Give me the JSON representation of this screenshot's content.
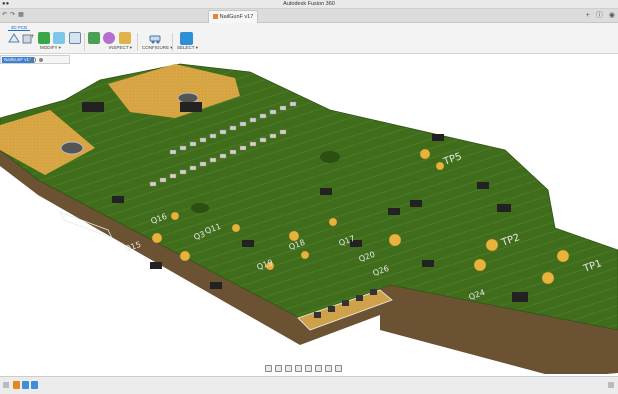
{
  "window": {
    "title": "Autodesk Fusion 360"
  },
  "document_tab": {
    "label": "NailGunF v17"
  },
  "workspace_tab": {
    "label": "3D PCB"
  },
  "toolbar": {
    "groups": [
      {
        "label": "MODIFY ▾"
      },
      {
        "label": "INSPECT ▾"
      },
      {
        "label": "CONFIGURE ▾"
      },
      {
        "label": "SELECT ▾"
      }
    ]
  },
  "browser": {
    "root_label": "NailGunF v17"
  },
  "pcb_labels": {
    "q3": "Q3",
    "tp1": "TP1",
    "tp2": "TP2",
    "tp5": "TP5",
    "q18": "Q18",
    "q19": "Q19",
    "q20": "Q20",
    "q17": "Q17",
    "q15": "Q15",
    "q11": "Q11",
    "q24": "Q24",
    "q26": "Q26",
    "q16": "Q16"
  },
  "colors": {
    "pcb_green": "#3f6d1c",
    "pcb_edge": "#6b5233",
    "copper_pad": "#d9a645",
    "silkscreen": "#e8e8e8",
    "accent": "#1e6cc9"
  }
}
